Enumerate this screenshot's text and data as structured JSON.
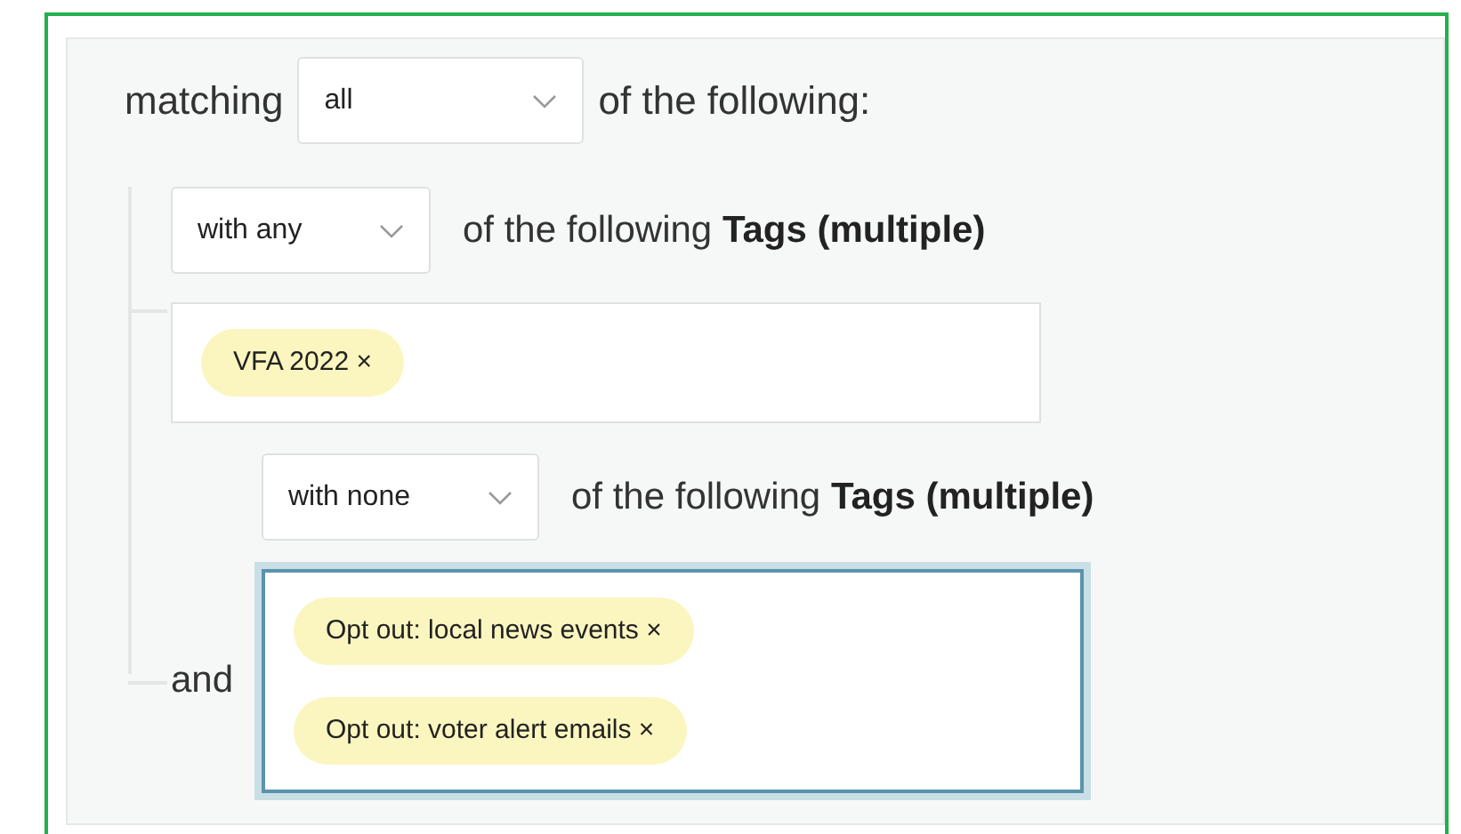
{
  "header": {
    "prefix": "matching",
    "select": "all",
    "suffix": "of the following:"
  },
  "conditions": [
    {
      "select": "with any",
      "text": "of the following",
      "bold": "Tags (multiple)",
      "focused": false,
      "tags": [
        "VFA 2022 ×"
      ]
    },
    {
      "select": "with none",
      "text": "of the following",
      "bold": "Tags (multiple)",
      "focused": true,
      "joiner": "and",
      "tags": [
        "Opt out: local news events ×",
        "Opt out: voter alert emails ×"
      ]
    }
  ]
}
